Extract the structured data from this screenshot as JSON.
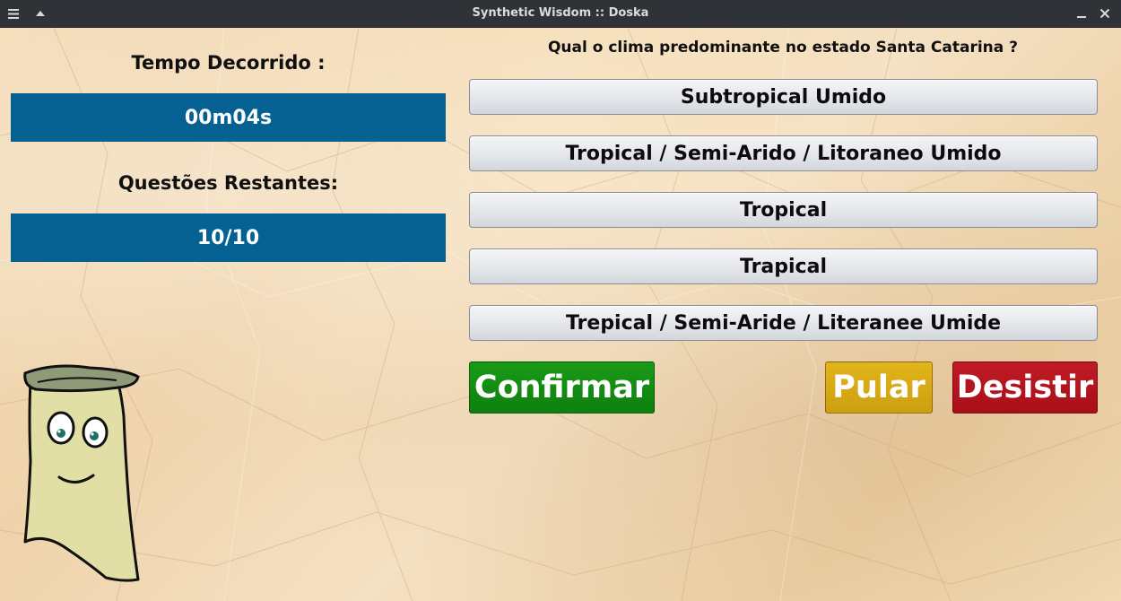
{
  "window": {
    "title": "Synthetic Wisdom :: Doska",
    "menu_icon": "hamburger-menu-icon",
    "up_icon": "caret-up-icon",
    "minimize_icon": "minimize-icon",
    "close_icon": "close-icon"
  },
  "timer": {
    "label": "Tempo Decorrido :",
    "value": "00m04s"
  },
  "remaining": {
    "label": "Questões Restantes:",
    "value": "10/10"
  },
  "question": {
    "text": "Qual o clima predominante no estado Santa Catarina ?"
  },
  "options": [
    "Subtropical Umido",
    "Tropical / Semi-Arido / Litoraneo Umido",
    "Tropical",
    "Trapical",
    "Trepical / Semi-Aride / Literanee Umide"
  ],
  "actions": {
    "confirm": "Confirmar",
    "skip": "Pular",
    "give_up": "Desistir"
  },
  "colors": {
    "panel": "#046192",
    "confirm": "#128a11",
    "skip": "#d8aa14",
    "give_up": "#b3131e"
  }
}
